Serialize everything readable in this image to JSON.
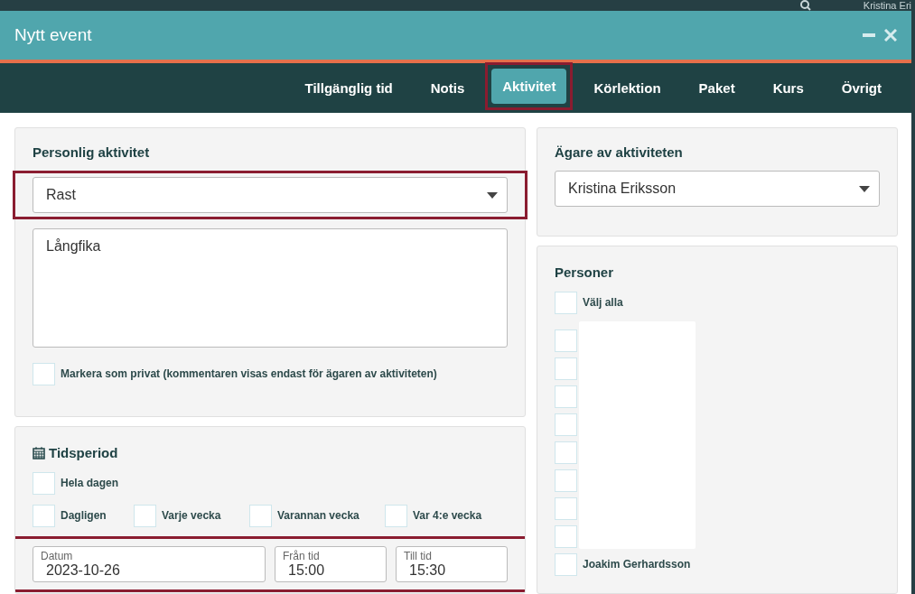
{
  "background": {
    "user_name": "Kristina Eri"
  },
  "window": {
    "title": "Nytt event"
  },
  "tabs": [
    {
      "label": "Tillgänglig tid",
      "selected": false,
      "highlighted": false
    },
    {
      "label": "Notis",
      "selected": false,
      "highlighted": false
    },
    {
      "label": "Aktivitet",
      "selected": true,
      "highlighted": true
    },
    {
      "label": "Körlektion",
      "selected": false,
      "highlighted": false
    },
    {
      "label": "Paket",
      "selected": false,
      "highlighted": false
    },
    {
      "label": "Kurs",
      "selected": false,
      "highlighted": false
    },
    {
      "label": "Övrigt",
      "selected": false,
      "highlighted": false
    }
  ],
  "activity": {
    "heading": "Personlig aktivitet",
    "type_select": {
      "value": "Rast",
      "highlighted": true
    },
    "comment": "Långfika",
    "private": {
      "label": "Markera som privat (kommentaren visas endast för ägaren av aktiviteten)",
      "checked": false
    }
  },
  "period": {
    "heading": "Tidsperiod",
    "all_day": {
      "label": "Hela dagen",
      "checked": false
    },
    "repeat": [
      {
        "label": "Dagligen",
        "checked": false
      },
      {
        "label": "Varje vecka",
        "checked": false
      },
      {
        "label": "Varannan vecka",
        "checked": false
      },
      {
        "label": "Var 4:e vecka",
        "checked": false
      }
    ],
    "highlighted": true,
    "fields": [
      {
        "label": "Datum",
        "value": "2023-10-26",
        "kind": "wide"
      },
      {
        "label": "Från tid",
        "value": "15:00",
        "kind": "narrow"
      },
      {
        "label": "Till tid",
        "value": "15:30",
        "kind": "narrow"
      }
    ]
  },
  "owner": {
    "heading": "Ägare av aktiviteten",
    "value": "Kristina Eriksson"
  },
  "persons": {
    "heading": "Personer",
    "select_all": {
      "label": "Välj alla",
      "checked": false
    },
    "redacted": true,
    "items": [
      {
        "checked": false
      },
      {
        "checked": false
      },
      {
        "checked": false
      },
      {
        "checked": false
      },
      {
        "checked": false
      },
      {
        "checked": false
      },
      {
        "checked": false
      },
      {
        "checked": false
      },
      {
        "label": "Joakim Gerhardsson",
        "checked": false
      }
    ]
  }
}
